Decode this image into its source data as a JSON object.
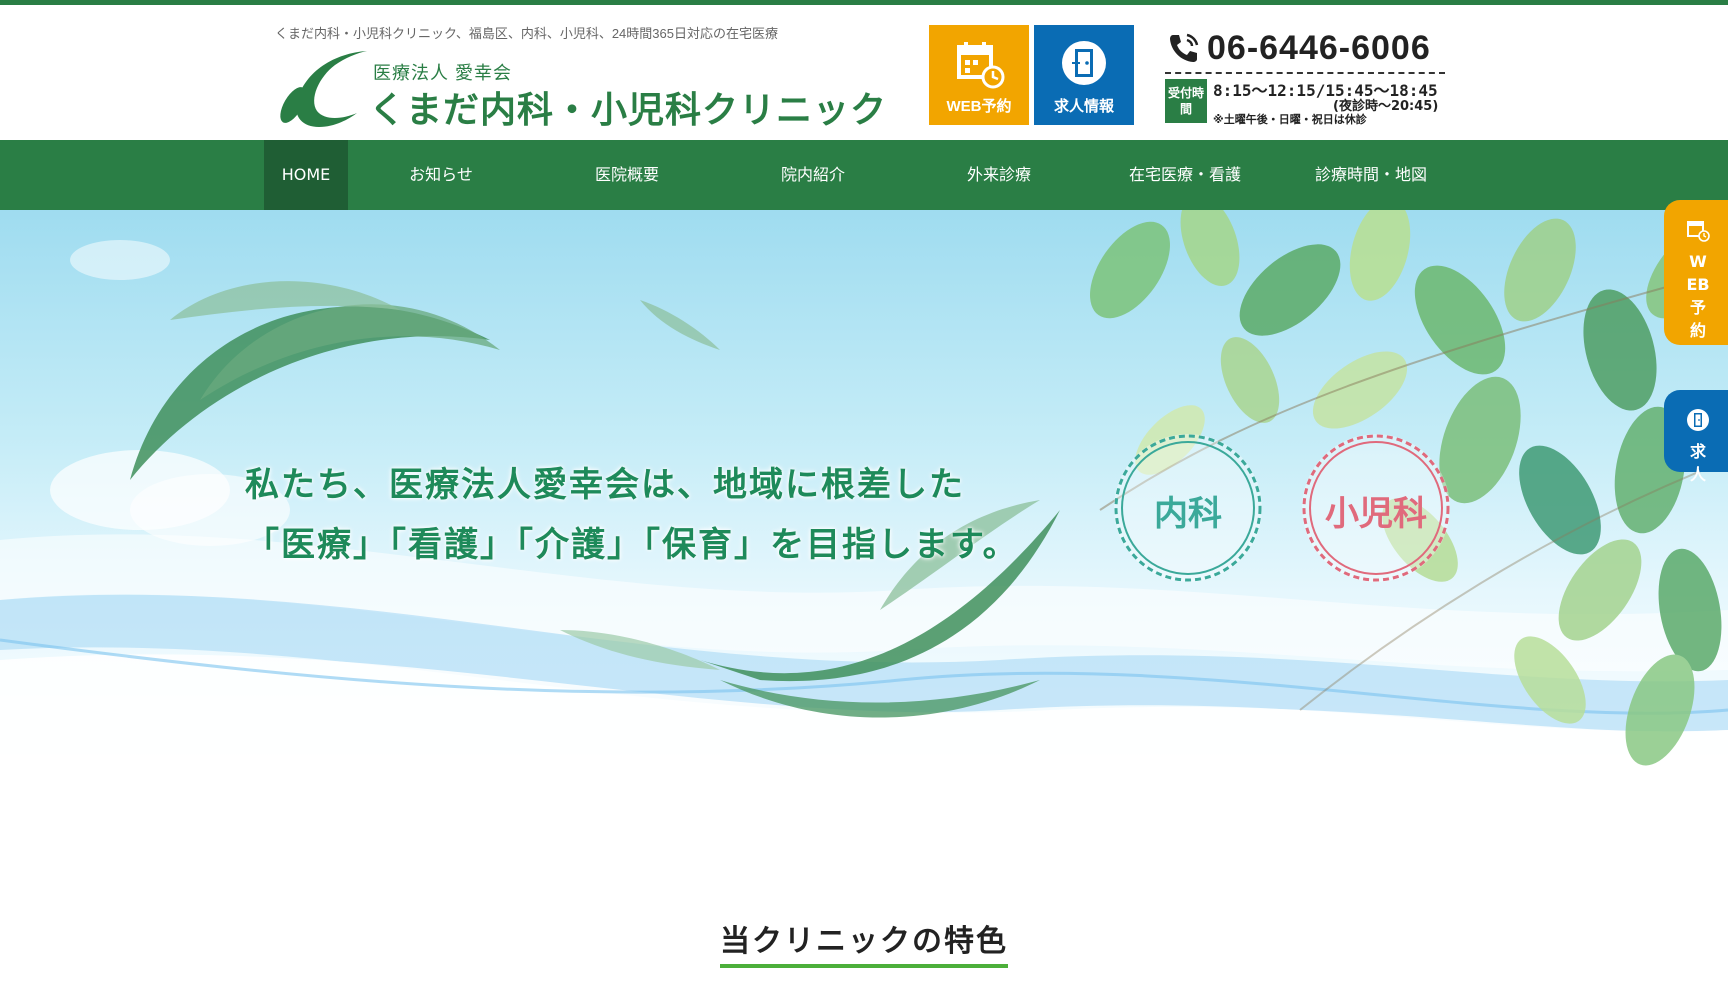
{
  "header": {
    "tagline": "くまだ内科・小児科クリニック、福島区、内科、小児科、24時間365日対応の在宅医療",
    "logo_sub": "医療法人 愛幸会",
    "logo_main": "くまだ内科・小児科クリニック",
    "web_button": "WEB予約",
    "recruit_button": "求人情報",
    "phone": "06-6446-6006",
    "hours_badge": "受付時間",
    "hours": "8:15〜12:15/15:45〜18:45",
    "hours_night": "(夜診時〜20:45)",
    "hours_note": "※土曜午後・日曜・祝日は休診"
  },
  "nav": {
    "items": [
      {
        "label": "HOME",
        "active": true
      },
      {
        "label": "お知らせ"
      },
      {
        "label": "医院概要"
      },
      {
        "label": "院内紹介"
      },
      {
        "label": "外来診療"
      },
      {
        "label": "在宅医療・看護"
      },
      {
        "label": "診療時間・地図"
      }
    ]
  },
  "hero": {
    "line1": "私たち、医療法人愛幸会は、地域に根差した",
    "line2": "「医療」「看護」「介護」「保育」を目指します。",
    "stamp_naika": "内科",
    "stamp_shonika": "小児科"
  },
  "side": {
    "web": "WEB予約",
    "recruit": "求人"
  },
  "features": {
    "title": "当クリニックの特色"
  },
  "colors": {
    "brand_green": "#2a7e45",
    "nav_active": "#1f5e34",
    "web_orange": "#f2a500",
    "recruit_blue": "#0a6cb4",
    "stamp_teal": "#3ba99a",
    "stamp_pink": "#e06a7c",
    "underline_green": "#4caf3a"
  },
  "icons": {
    "web": "calendar-clock-icon",
    "recruit": "door-icon",
    "phone": "phone-icon"
  }
}
